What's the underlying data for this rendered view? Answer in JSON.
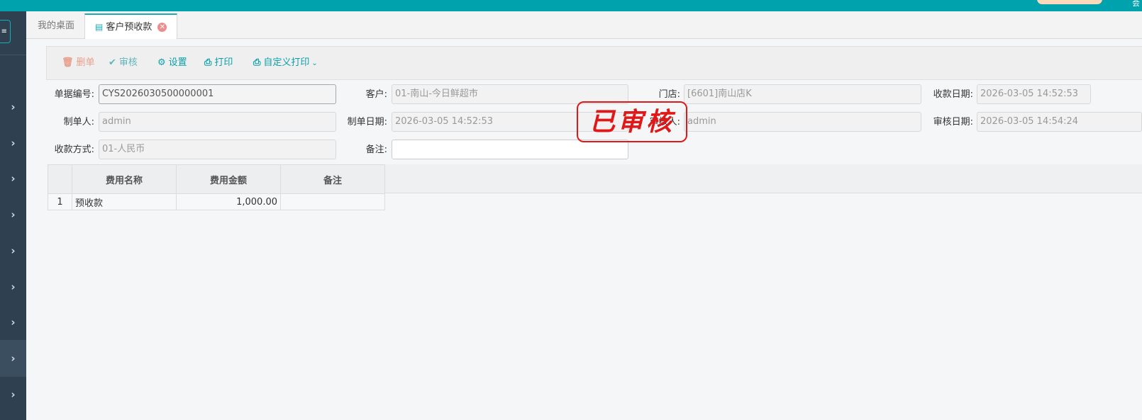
{
  "topbar": {
    "corner_char": "会"
  },
  "sidebar": {
    "toggle_icon": "≡",
    "items": [
      {
        "icon": "chevron-right-icon",
        "glyph": "›"
      },
      {
        "icon": "chevron-right-icon",
        "glyph": "›"
      },
      {
        "icon": "chevron-right-icon",
        "glyph": "›"
      },
      {
        "icon": "chevron-right-icon",
        "glyph": "›"
      },
      {
        "icon": "chevron-right-icon",
        "glyph": "›"
      },
      {
        "icon": "chevron-right-icon",
        "glyph": "›"
      },
      {
        "icon": "chevron-right-icon",
        "glyph": "›"
      },
      {
        "icon": "chevron-right-icon",
        "glyph": "›"
      },
      {
        "icon": "chevron-right-icon",
        "glyph": "›"
      }
    ]
  },
  "tabs": [
    {
      "label": "我的桌面"
    },
    {
      "label": "客户预收款"
    }
  ],
  "toolbar": {
    "delete_label": "删单",
    "audit_label": "审核",
    "settings_label": "设置",
    "print_label": "打印",
    "custom_print_label": "自定义打印"
  },
  "form": {
    "doc_no_label": "单据编号:",
    "doc_no_value": "CYS2026030500000001",
    "customer_label": "客户:",
    "customer_value": "01-南山-今日鲜超市",
    "store_label": "门店:",
    "store_value": "[6601]南山店K",
    "receipt_date_label": "收款日期:",
    "receipt_date_value": "2026-03-05 14:52:53",
    "creator_label": "制单人:",
    "creator_value": "admin",
    "create_date_label": "制单日期:",
    "create_date_value": "2026-03-05 14:52:53",
    "auditor_label": "审核人:",
    "auditor_value": "admin",
    "audit_date_label": "审核日期:",
    "audit_date_value": "2026-03-05 14:54:24",
    "payment_method_label": "收款方式:",
    "payment_method_value": "01-人民币",
    "remark_label": "备注:",
    "remark_value": ""
  },
  "stamp": {
    "text": "已审核",
    "color": "#e01818"
  },
  "grid": {
    "headers": [
      "费用名称",
      "费用金额",
      "备注"
    ],
    "rows": [
      {
        "num": "1",
        "name": "预收款",
        "amount": "1,000.00",
        "remark": ""
      }
    ]
  },
  "colors": {
    "accent": "#00a2ad",
    "sidebar": "#2f4050",
    "stamp": "#e01818"
  }
}
